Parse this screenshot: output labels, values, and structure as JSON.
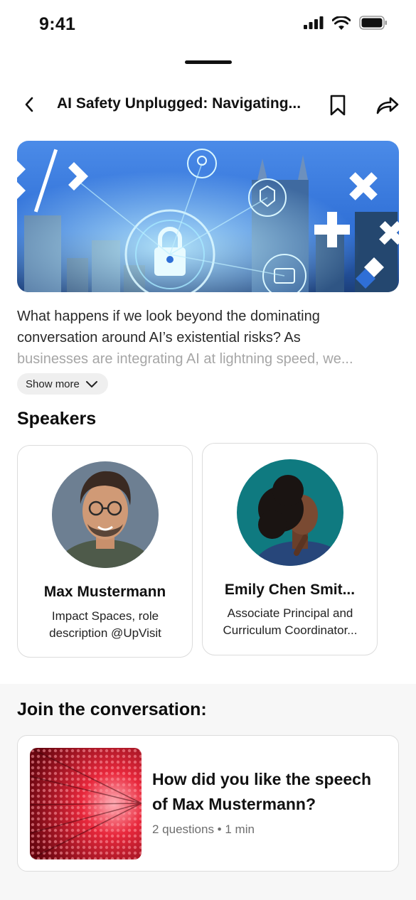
{
  "status_bar": {
    "time": "9:41"
  },
  "header": {
    "title": "AI Safety Unplugged: Navigating..."
  },
  "description": {
    "lines": [
      "What happens if we look beyond the dominating",
      "conversation around AI’s existential risks? As",
      "businesses are integrating AI at lightning speed, we..."
    ],
    "show_more_label": "Show more"
  },
  "speakers": {
    "heading": "Speakers",
    "items": [
      {
        "name": "Max Mustermann",
        "role_lines": [
          "Impact Spaces, role",
          "description @UpVisit"
        ]
      },
      {
        "name": "Emily Chen Smit...",
        "role_lines": [
          "Associate Principal and",
          "Curriculum Coordinator..."
        ]
      }
    ]
  },
  "conversation": {
    "heading": "Join the conversation:",
    "card": {
      "title_lines": [
        "How did you like the speech",
        "of Max Mustermann?"
      ],
      "meta": "2 questions • 1 min"
    }
  },
  "icons": {
    "back": "chevron-left-icon",
    "bookmark": "bookmark-icon",
    "share": "share-arrow-icon",
    "show_more": "chevron-down-icon"
  },
  "colors": {
    "hero_blue": "#2f6fd6",
    "card_border": "#dcdcdc",
    "conversation_bg": "#f7f7f7",
    "thumb_red": "#d8152a"
  }
}
